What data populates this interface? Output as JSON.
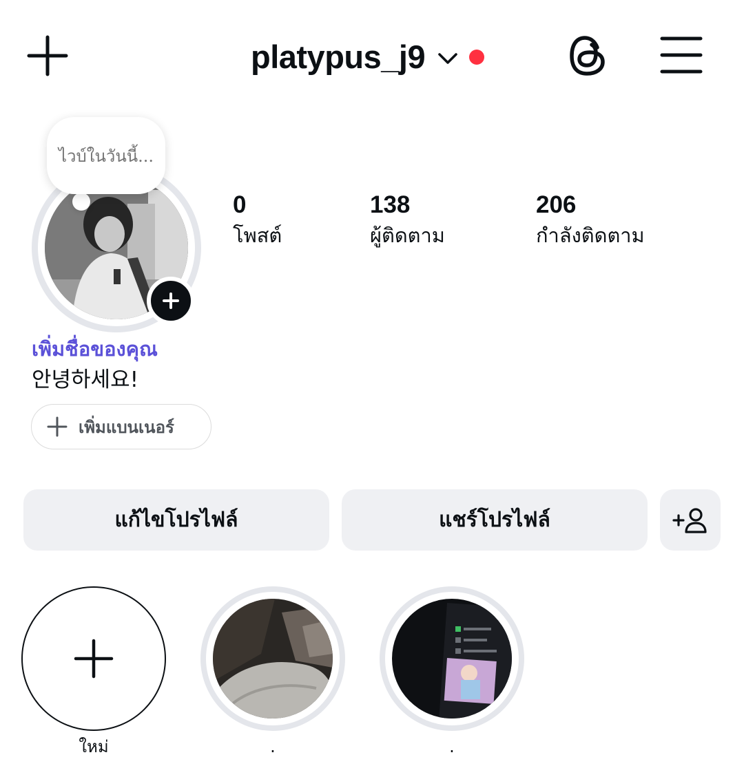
{
  "header": {
    "username": "platypus_j9",
    "icons": [
      "plus-icon",
      "chevron-down-icon",
      "threads-icon",
      "hamburger-menu-icon"
    ],
    "notification_dot_color": "#ff3040"
  },
  "note": {
    "placeholder": "ไวบ์ในวันนี้..."
  },
  "stats": [
    {
      "value": "0",
      "label": "โพสต์"
    },
    {
      "value": "138",
      "label": "ผู้ติดตาม"
    },
    {
      "value": "206",
      "label": "กำลังติดตาม"
    }
  ],
  "profile": {
    "add_name": "เพิ่มชื่อของคุณ",
    "bio": "안녕하세요!",
    "add_banner": "เพิ่มแบนเนอร์",
    "accent_color": "#5b51d8"
  },
  "actions": {
    "edit_profile": "แก้ไขโปรไฟล์",
    "share_profile": "แชร์โปรไฟล์",
    "discover_icon": "add-person-icon"
  },
  "highlights": [
    {
      "label": "ใหม่"
    },
    {
      "label": "."
    },
    {
      "label": "."
    }
  ]
}
